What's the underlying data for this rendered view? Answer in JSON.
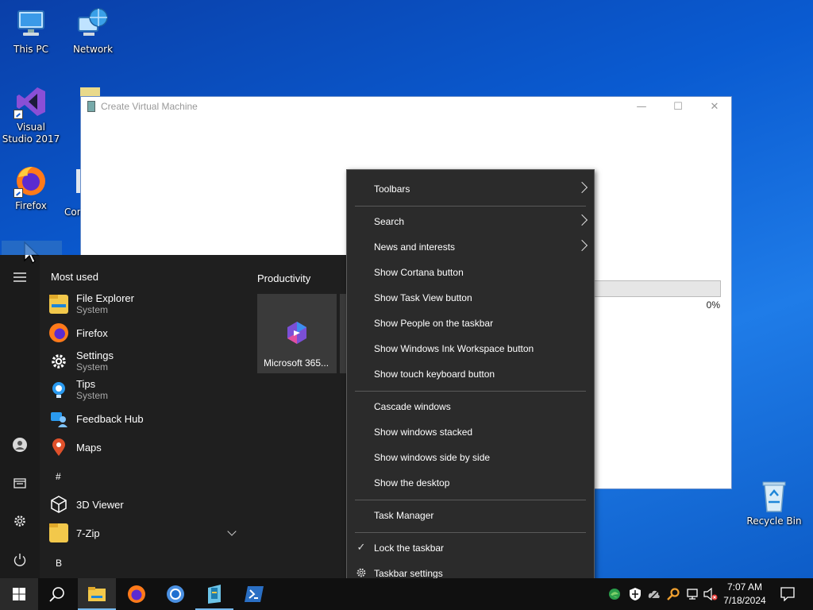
{
  "desktop": {
    "icons": [
      {
        "label": "This PC",
        "icon": "computer-icon"
      },
      {
        "label": "Network",
        "icon": "network-icon"
      },
      {
        "label": "Visual Studio 2017",
        "icon": "visual-studio-icon"
      },
      {
        "label": "Firefox",
        "icon": "firefox-icon"
      },
      {
        "label": "Con",
        "icon": "control-panel-icon"
      },
      {
        "label": "Recycle Bin",
        "icon": "recycle-bin-icon"
      }
    ]
  },
  "dialog": {
    "title": "Create Virtual Machine",
    "progress_text": "0%",
    "progress_value": 0
  },
  "start_menu": {
    "most_used_title": "Most used",
    "apps": [
      {
        "name": "File Explorer",
        "sub": "System",
        "icon": "folder-icon"
      },
      {
        "name": "Firefox",
        "sub": "",
        "icon": "firefox-icon"
      },
      {
        "name": "Settings",
        "sub": "System",
        "icon": "gear-icon"
      },
      {
        "name": "Tips",
        "sub": "System",
        "icon": "lightbulb-icon"
      },
      {
        "name": "Feedback Hub",
        "sub": "",
        "icon": "feedback-icon"
      },
      {
        "name": "Maps",
        "sub": "",
        "icon": "map-pin-icon"
      },
      {
        "name": "3D Viewer",
        "sub": "",
        "icon": "cube-icon"
      },
      {
        "name": "7-Zip",
        "sub": "",
        "icon": "folder-icon"
      }
    ],
    "letters": [
      "#",
      "B"
    ],
    "productivity_title": "Productivity",
    "tile_label": "Microsoft 365..."
  },
  "context_menu": {
    "items": [
      {
        "label": "Toolbars",
        "submenu": true
      },
      {
        "label": "Search",
        "submenu": true
      },
      {
        "label": "News and interests",
        "submenu": true
      },
      {
        "label": "Show Cortana button",
        "submenu": false
      },
      {
        "label": "Show Task View button",
        "submenu": false
      },
      {
        "label": "Show People on the taskbar",
        "submenu": false
      },
      {
        "label": "Show Windows Ink Workspace button",
        "submenu": false
      },
      {
        "label": "Show touch keyboard button",
        "submenu": false
      },
      {
        "label": "Cascade windows",
        "submenu": false
      },
      {
        "label": "Show windows stacked",
        "submenu": false
      },
      {
        "label": "Show windows side by side",
        "submenu": false
      },
      {
        "label": "Show the desktop",
        "submenu": false
      },
      {
        "label": "Task Manager",
        "submenu": false
      },
      {
        "label": "Lock the taskbar",
        "checked": true
      },
      {
        "label": "Taskbar settings",
        "icon": "gear-icon"
      }
    ]
  },
  "taskbar": {
    "time": "7:07 AM",
    "date": "7/18/2024",
    "accent": "#76b9ed"
  }
}
